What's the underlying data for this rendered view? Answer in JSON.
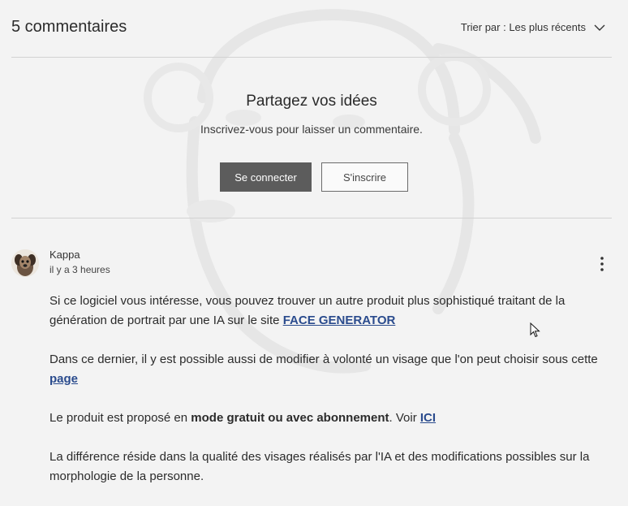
{
  "header": {
    "count_label": "5 commentaires",
    "sort_label": "Trier par : Les plus récents"
  },
  "share": {
    "title": "Partagez vos idées",
    "subtitle": "Inscrivez-vous pour laisser un commentaire.",
    "login_label": "Se connecter",
    "signup_label": "S'inscrire"
  },
  "comment": {
    "author": "Kappa",
    "time": "il y a 3 heures",
    "p1_text": "Si ce logiciel vous intéresse, vous pouvez trouver un autre produit plus sophistiqué traitant de la génération de portrait par une IA sur le site ",
    "p1_link": "FACE GENERATOR",
    "p2_text": "Dans ce dernier, il y est possible aussi de modifier à volonté un visage que l'on peut choisir  sous cette ",
    "p2_link": "page",
    "p3_text_a": "Le produit est proposé en ",
    "p3_bold": "mode gratuit ou avec abonnement",
    "p3_text_b": ". Voir ",
    "p3_link": "ICI ",
    "p4_text": "La différence réside dans la qualité des visages réalisés par l'IA et des modifications possibles sur la morphologie de la personne."
  },
  "icons": {
    "sort": "chevron-down-icon",
    "more": "more-vertical-icon",
    "cursor": "mouse-pointer-icon"
  },
  "colors": {
    "primary_button": "#5c5c5c",
    "link": "#2a4b8d",
    "divider": "#d2d2d2",
    "background": "#f3f3f3"
  }
}
